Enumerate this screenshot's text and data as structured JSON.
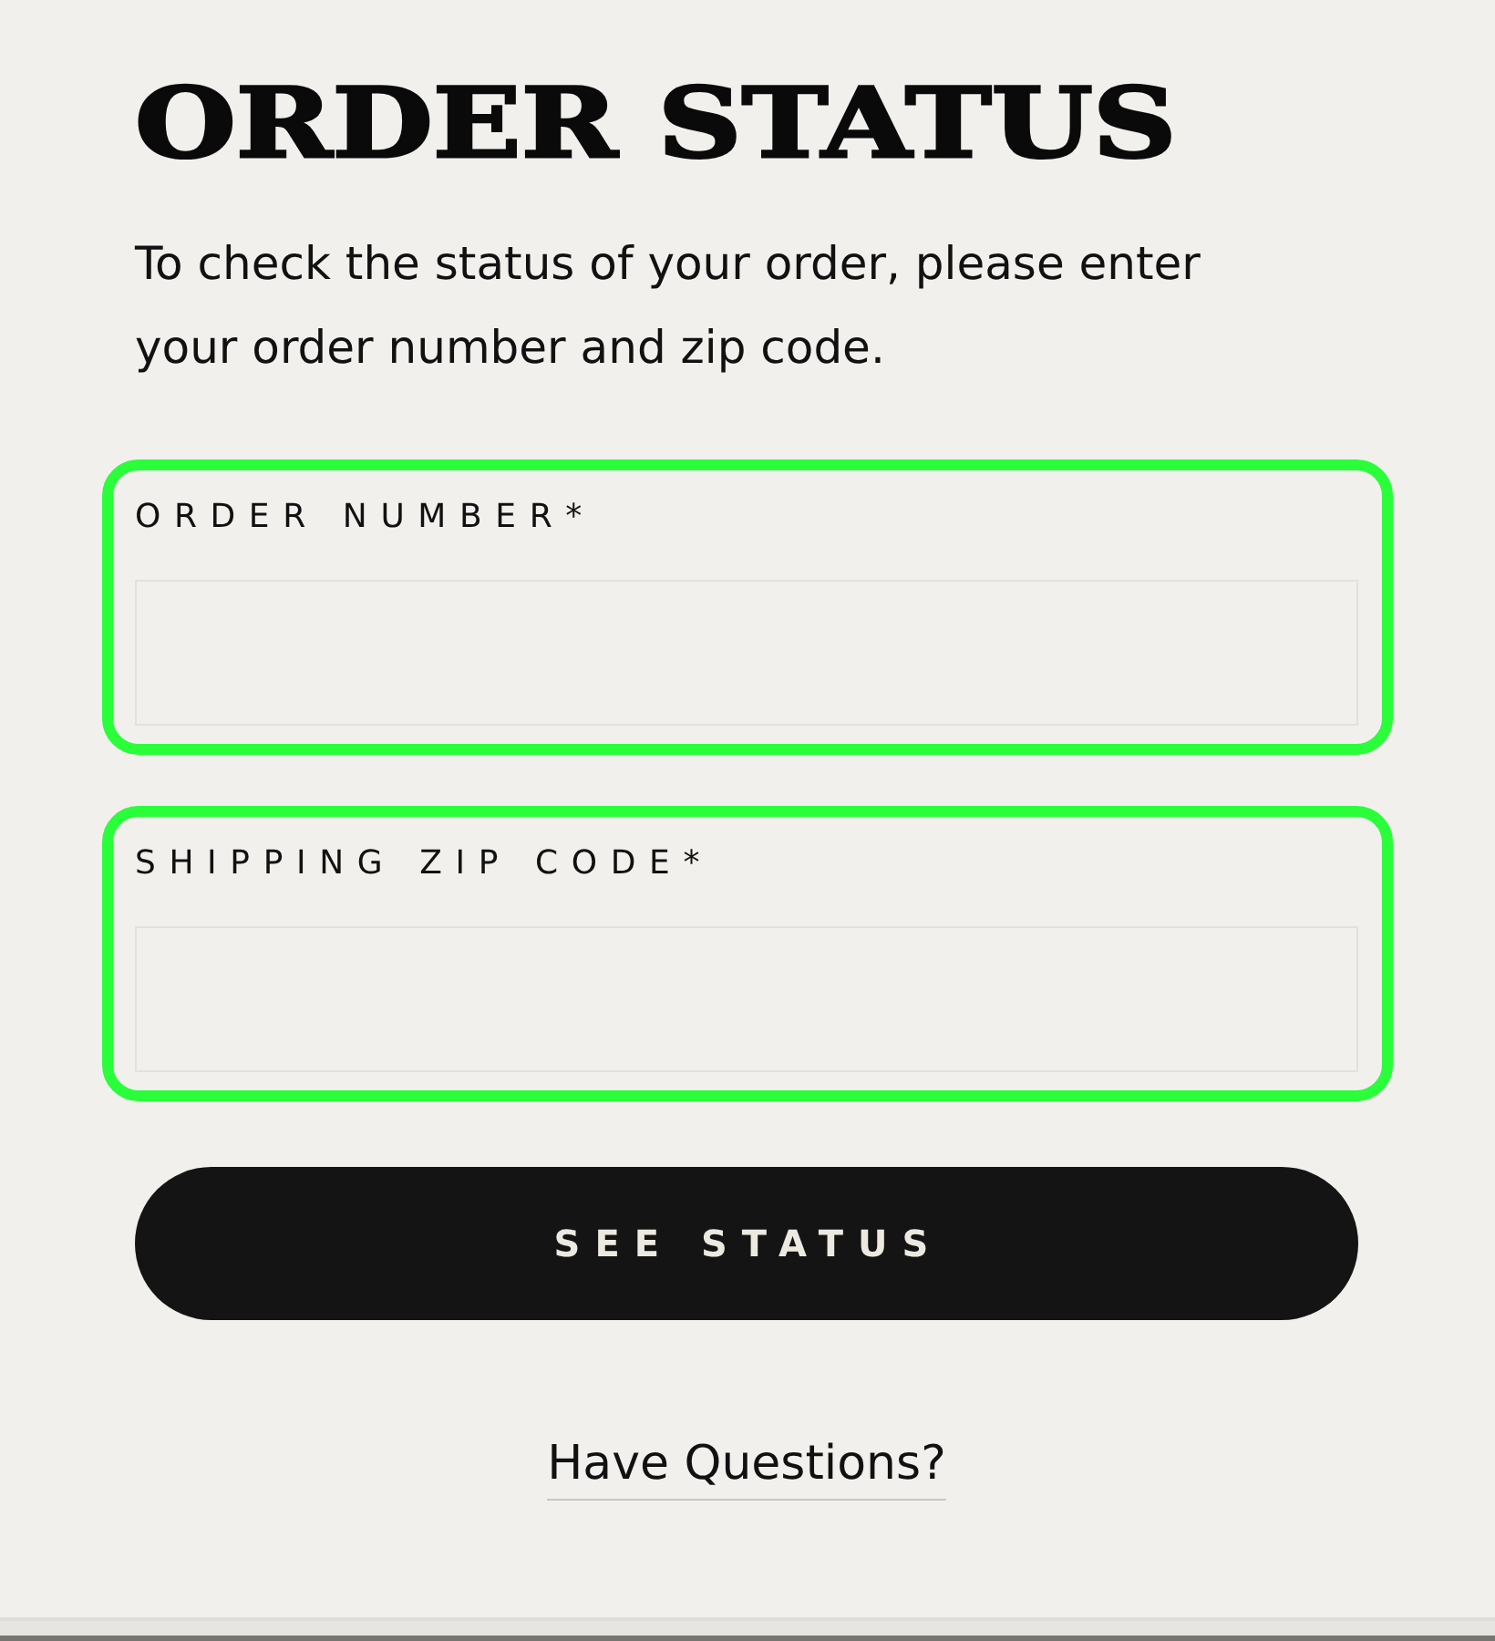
{
  "page": {
    "title": "ORDER STATUS",
    "intro": "To check the status of your order, please enter your order number and zip code."
  },
  "fields": [
    {
      "label": "ORDER NUMBER*",
      "highlighted": true
    },
    {
      "label": "SHIPPING ZIP CODE*",
      "highlighted": true
    }
  ],
  "submit_button": {
    "label": "SEE STATUS"
  },
  "help_link": {
    "label": "Have Questions?"
  }
}
